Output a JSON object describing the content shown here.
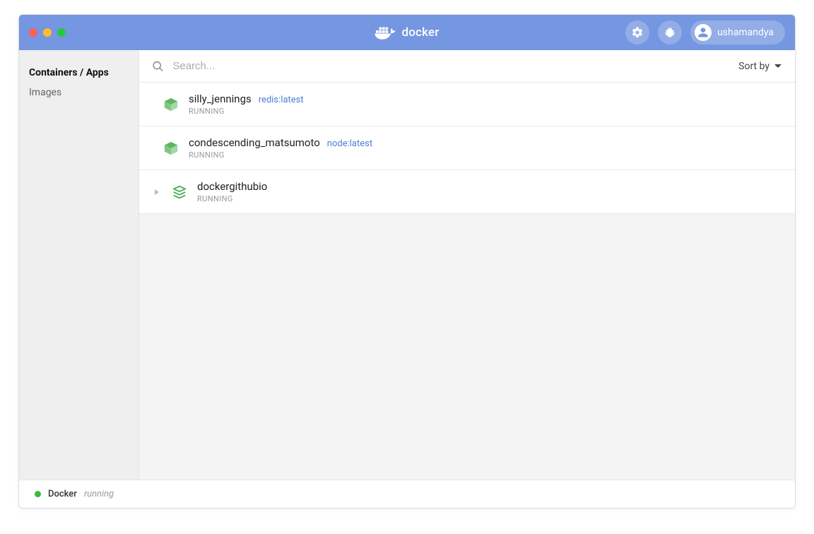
{
  "brand": {
    "name": "docker"
  },
  "user": {
    "name": "ushamandya"
  },
  "sidebar": {
    "items": [
      {
        "label": "Containers / Apps",
        "active": true
      },
      {
        "label": "Images",
        "active": false
      }
    ]
  },
  "toolbar": {
    "search_placeholder": "Search...",
    "sort_label": "Sort by"
  },
  "containers": [
    {
      "name": "silly_jennings",
      "image": "redis:latest",
      "status": "RUNNING",
      "kind": "container"
    },
    {
      "name": "condescending_matsumoto",
      "image": "node:latest",
      "status": "RUNNING",
      "kind": "container"
    },
    {
      "name": "dockergithubio",
      "image": "",
      "status": "RUNNING",
      "kind": "stack"
    }
  ],
  "footer": {
    "name": "Docker",
    "status": "running"
  }
}
